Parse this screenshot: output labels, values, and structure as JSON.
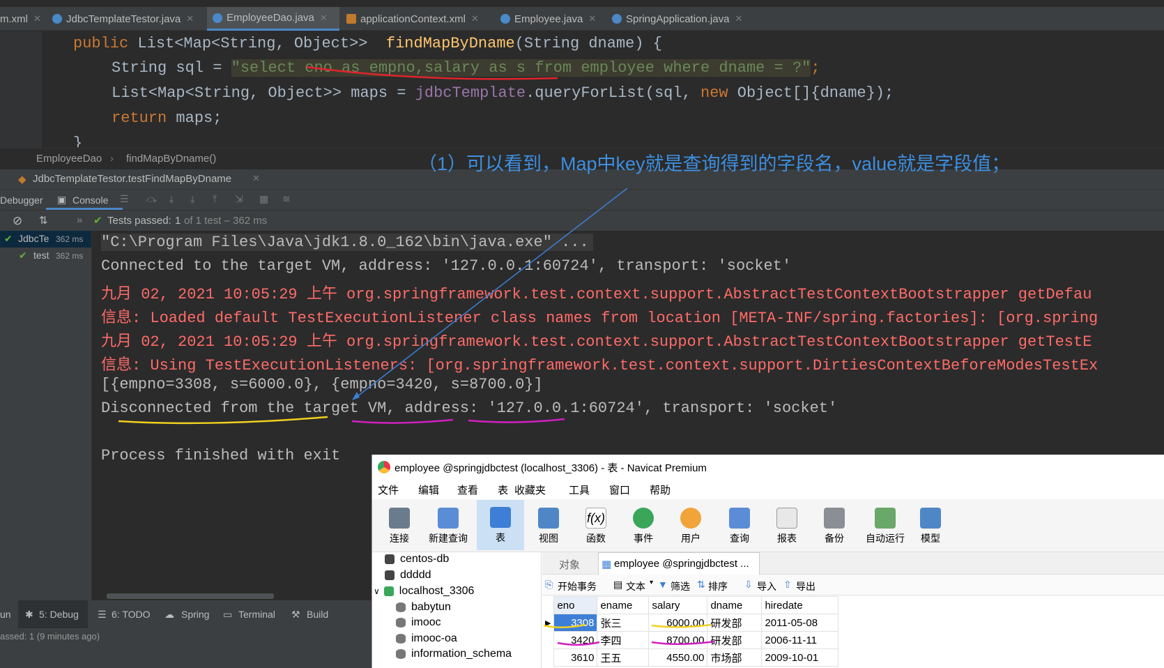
{
  "tabs": [
    {
      "label": "m.xml",
      "icon": "xml-icon",
      "active": false
    },
    {
      "label": "JdbcTemplateTestor.java",
      "icon": "java-class-icon",
      "active": false
    },
    {
      "label": "EmployeeDao.java",
      "icon": "java-class-icon",
      "active": true
    },
    {
      "label": "applicationContext.xml",
      "icon": "xml-icon",
      "active": false
    },
    {
      "label": "Employee.java",
      "icon": "java-class-icon",
      "active": false
    },
    {
      "label": "SpringApplication.java",
      "icon": "java-class-icon",
      "active": false
    }
  ],
  "code": {
    "line1_kw": "public",
    "line1_type": "List<Map<String, Object>>",
    "line1_fn": "findMapByDname",
    "line1_params": "(String dname) {",
    "line2_a": "String sql = ",
    "line2_sql": "\"select eno as empno,salary as s from employee where dname = ?\"",
    "line2_end": ";",
    "line3_a": "List<Map<String, Object>> maps = ",
    "line3_fld": "jdbcTemplate",
    "line3_b": ".queryForList(sql, ",
    "line3_kw": "new",
    "line3_c": " Object[]{dname});",
    "line4_kw": "return",
    "line4_b": " maps;",
    "line5": "}"
  },
  "breadcrumb": {
    "class": "EmployeeDao",
    "method": "findMapByDname()"
  },
  "run_tab": {
    "label": "JdbcTemplateTestor.testFindMapByDname"
  },
  "tool_tabs": {
    "debugger": "Debugger",
    "console": "Console"
  },
  "test_status": {
    "passed_label": "Tests passed:",
    "count": "1",
    "suffix": "of 1 test – 362 ms"
  },
  "test_tree": [
    {
      "label": "JdbcTe",
      "time": "362 ms"
    },
    {
      "label": "test",
      "time": "362 ms"
    }
  ],
  "console_lines": [
    {
      "text": "\"C:\\Program Files\\Java\\jdk1.8.0_162\\bin\\java.exe\" ...",
      "style": "normal"
    },
    {
      "text": "Connected to the target VM, address: '127.0.0.1:60724', transport: 'socket'",
      "style": "normal"
    },
    {
      "text": "九月 02, 2021 10:05:29 上午 org.springframework.test.context.support.AbstractTestContextBootstrapper getDefau",
      "style": "red"
    },
    {
      "text": "信息: Loaded default TestExecutionListener class names from location [META-INF/spring.factories]: [org.spring",
      "style": "red"
    },
    {
      "text": "九月 02, 2021 10:05:29 上午 org.springframework.test.context.support.AbstractTestContextBootstrapper getTestE",
      "style": "red"
    },
    {
      "text": "信息: Using TestExecutionListeners: [org.springframework.test.context.support.DirtiesContextBeforeModesTestEx",
      "style": "red"
    },
    {
      "text": "[{empno=3308, s=6000.0}, {empno=3420, s=8700.0}]",
      "style": "normal"
    },
    {
      "text": "Disconnected from the target VM, address: '127.0.0.1:60724', transport: 'socket'",
      "style": "normal"
    },
    {
      "text": "",
      "style": "normal"
    },
    {
      "text": "Process finished with exit",
      "style": "normal"
    }
  ],
  "annotation": "（1）可以看到，Map中key就是查询得到的字段名，value就是字段值；",
  "bottom_tabs": [
    "un",
    "5: Debug",
    "6: TODO",
    "Spring",
    "Terminal",
    "Build"
  ],
  "status_text": "assed: 1 (9 minutes ago)",
  "navicat": {
    "title": "employee @springjdbctest (localhost_3306) - 表 - Navicat Premium",
    "menu": [
      "文件",
      "编辑",
      "查看",
      "表",
      "收藏夹",
      "工具",
      "窗口",
      "帮助"
    ],
    "toolbar": [
      "连接",
      "新建查询",
      "表",
      "视图",
      "函数",
      "事件",
      "用户",
      "查询",
      "报表",
      "备份",
      "自动运行",
      "模型"
    ],
    "connections": [
      "centos-db",
      "ddddd",
      "localhost_3306"
    ],
    "databases": [
      "babytun",
      "imooc",
      "imooc-oa",
      "information_schema"
    ],
    "object_tab": "对象",
    "table_tab": "employee @springjdbctest ...",
    "table_toolbar": [
      "开始事务",
      "文本",
      "筛选",
      "排序",
      "导入",
      "导出"
    ],
    "columns": [
      "eno",
      "ename",
      "salary",
      "dname",
      "hiredate"
    ],
    "rows": [
      [
        "3308",
        "张三",
        "6000.00",
        "研发部",
        "2011-05-08"
      ],
      [
        "3420",
        "李四",
        "8700.00",
        "研发部",
        "2006-11-11"
      ],
      [
        "3610",
        "王五",
        "4550.00",
        "市场部",
        "2009-10-01"
      ]
    ]
  }
}
